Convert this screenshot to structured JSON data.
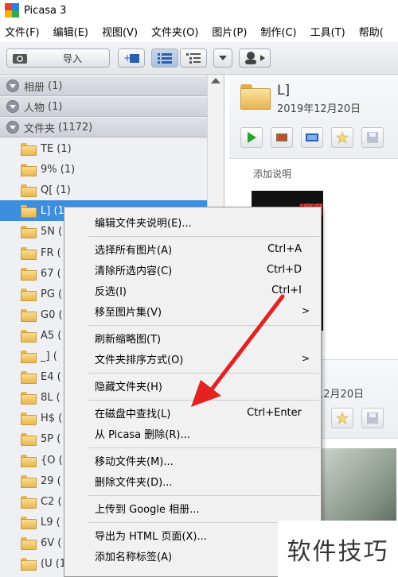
{
  "titlebar": {
    "title": "Picasa 3"
  },
  "menubar": [
    "文件(F)",
    "编辑(E)",
    "视图(V)",
    "文件夹(O)",
    "图片(P)",
    "制作(C)",
    "工具(T)",
    "帮助("
  ],
  "toolbar": {
    "import_label": "导入"
  },
  "sidebar": {
    "sections": [
      {
        "label": "相册",
        "count": "(1)"
      },
      {
        "label": "人物",
        "count": "(1)"
      },
      {
        "label": "文件夹",
        "count": "(1172)"
      }
    ],
    "folders": [
      "TE (1)",
      "9% (1)",
      "Q[ (1)",
      "L] (1",
      "5N (",
      "FR (",
      "67 (",
      "PG (",
      "G0 (",
      "A5 (",
      "_] (",
      "E4 (",
      "8L (",
      "H$ (",
      "5P (",
      "{O (",
      "29 (",
      "C2 (",
      "L9 (",
      "6V (",
      "(U (1"
    ],
    "selected_index": 3
  },
  "album": {
    "name": "L]",
    "date": "2019年12月20日",
    "caption": "添加说明",
    "thumb_text": "嘿嘿",
    "date2": "12月20日"
  },
  "context_menu": {
    "items": [
      {
        "label": "编辑文件夹说明(E)...",
        "shortcut": ""
      },
      {
        "label": "选择所有图片(A)",
        "shortcut": "Ctrl+A"
      },
      {
        "label": "清除所选内容(C)",
        "shortcut": "Ctrl+D"
      },
      {
        "label": "反选(I)",
        "shortcut": "Ctrl+I"
      },
      {
        "label": "移至图片集(V)",
        "shortcut": "",
        "submenu": ">"
      },
      {
        "label": "刷新缩略图(T)",
        "shortcut": ""
      },
      {
        "label": "文件夹排序方式(O)",
        "shortcut": "",
        "submenu": ">"
      },
      {
        "label": "隐藏文件夹(H)",
        "shortcut": ""
      },
      {
        "label": "在磁盘中查找(L)",
        "shortcut": "Ctrl+Enter"
      },
      {
        "label": "从 Picasa 删除(R)...",
        "shortcut": ""
      },
      {
        "label": "移动文件夹(M)...",
        "shortcut": ""
      },
      {
        "label": "删除文件夹(D)...",
        "shortcut": ""
      },
      {
        "label": "上传到 Google 相册...",
        "shortcut": ""
      },
      {
        "label": "导出为 HTML 页面(X)...",
        "shortcut": ""
      },
      {
        "label": "添加名称标签(A)",
        "shortcut": ""
      }
    ]
  },
  "watermark": "软件技巧",
  "colors": {
    "selection": "#3e8ee0",
    "annotation_arrow": "#e32222",
    "play": "#2aa12a"
  }
}
